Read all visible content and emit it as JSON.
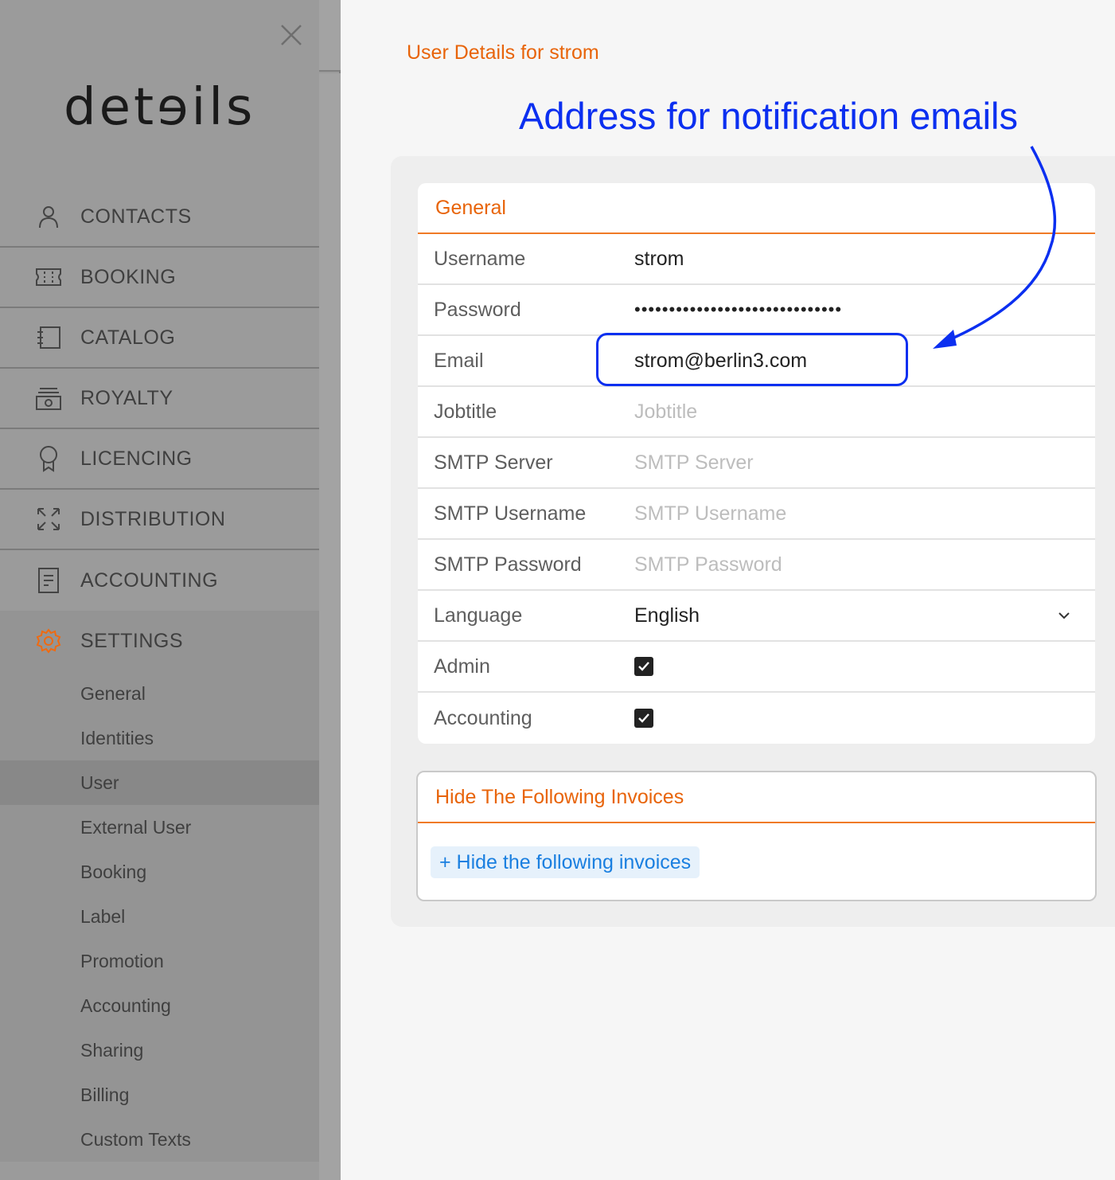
{
  "sidebar": {
    "logo": "detɘils",
    "nav": [
      {
        "label": "CONTACTS",
        "icon": "person-icon"
      },
      {
        "label": "BOOKING",
        "icon": "ticket-icon"
      },
      {
        "label": "CATALOG",
        "icon": "catalog-icon"
      },
      {
        "label": "ROYALTY",
        "icon": "money-icon"
      },
      {
        "label": "LICENCING",
        "icon": "award-icon"
      },
      {
        "label": "DISTRIBUTION",
        "icon": "expand-arrows-icon"
      },
      {
        "label": "ACCOUNTING",
        "icon": "document-icon"
      }
    ],
    "settings": {
      "label": "SETTINGS",
      "icon": "gear-icon",
      "items": [
        "General",
        "Identities",
        "User",
        "External User",
        "Booking",
        "Label",
        "Promotion",
        "Accounting",
        "Sharing",
        "Billing",
        "Custom Texts"
      ],
      "active": "User"
    }
  },
  "main": {
    "title": "User Details for strom",
    "annotation": "Address for notification emails",
    "general": {
      "heading": "General",
      "username_label": "Username",
      "username_value": "strom",
      "password_label": "Password",
      "password_value": "••••••••••••••••••••••••••••••",
      "email_label": "Email",
      "email_value": "strom@berlin3.com",
      "jobtitle_label": "Jobtitle",
      "jobtitle_placeholder": "Jobtitle",
      "smtp_server_label": "SMTP Server",
      "smtp_server_placeholder": "SMTP Server",
      "smtp_username_label": "SMTP Username",
      "smtp_username_placeholder": "SMTP Username",
      "smtp_password_label": "SMTP Password",
      "smtp_password_placeholder": "SMTP Password",
      "language_label": "Language",
      "language_value": "English",
      "admin_label": "Admin",
      "admin_checked": true,
      "accounting_label": "Accounting",
      "accounting_checked": true
    },
    "invoices": {
      "heading": "Hide The Following Invoices",
      "add_button": "+ Hide the following invoices"
    }
  },
  "colors": {
    "accent": "#e8640a",
    "annotation": "#0b2ff0",
    "link": "#1a7fe0"
  }
}
